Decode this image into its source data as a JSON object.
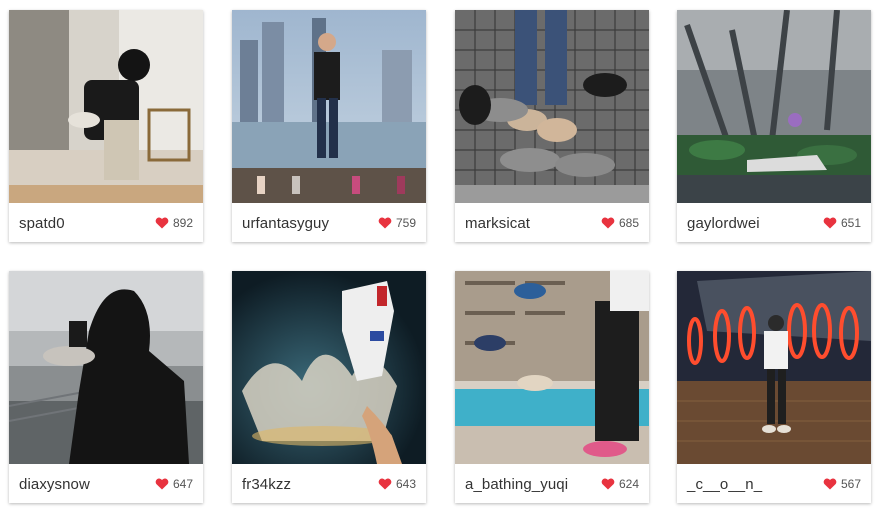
{
  "colors": {
    "heart": "#e8333f",
    "username_text": "#333333",
    "likes_text": "#555555"
  },
  "posts": [
    {
      "username": "spatd0",
      "likes": "892",
      "icon": "heart-icon"
    },
    {
      "username": "urfantasyguy",
      "likes": "759",
      "icon": "heart-icon"
    },
    {
      "username": "marksicat",
      "likes": "685",
      "icon": "heart-icon"
    },
    {
      "username": "gaylordwei",
      "likes": "651",
      "icon": "heart-icon"
    },
    {
      "username": "diaxysnow",
      "likes": "647",
      "icon": "heart-icon"
    },
    {
      "username": "fr34kzz",
      "likes": "643",
      "icon": "heart-icon"
    },
    {
      "username": "a_bathing_yuqi",
      "likes": "624",
      "icon": "heart-icon"
    },
    {
      "username": "_c__o__n_",
      "likes": "567",
      "icon": "heart-icon"
    }
  ]
}
